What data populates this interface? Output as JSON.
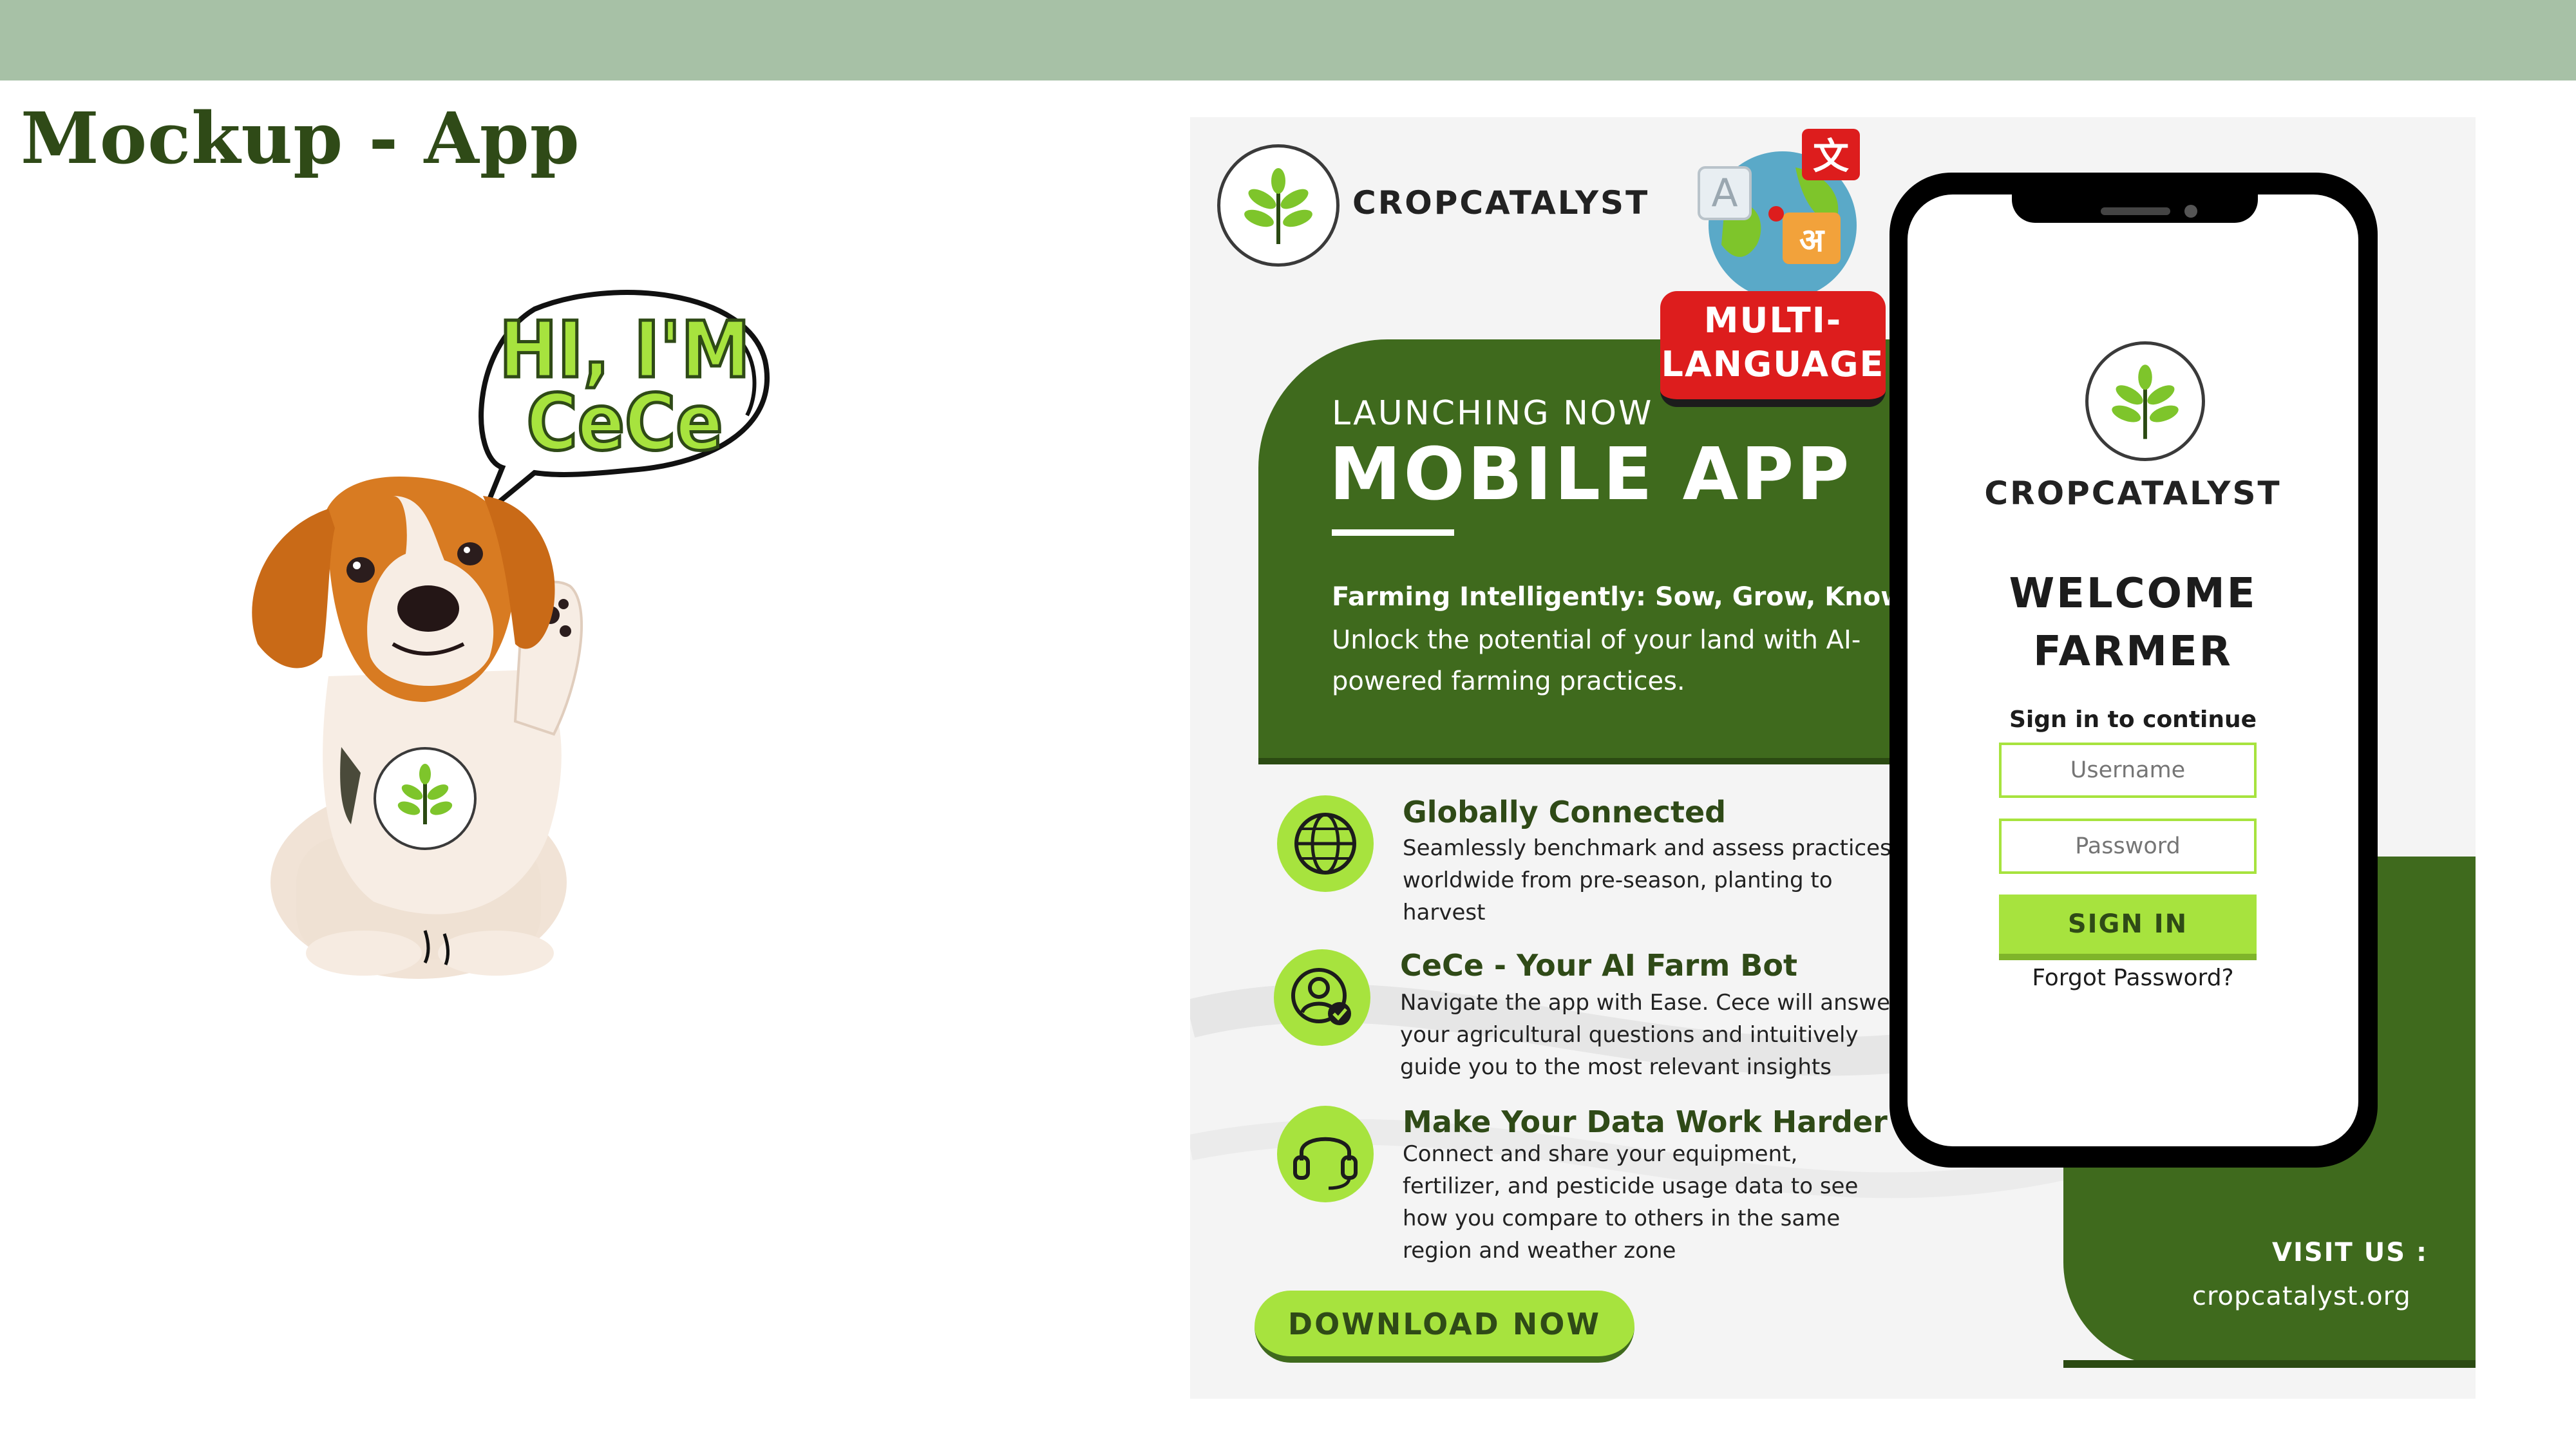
{
  "slide": {
    "title": "Mockup - App"
  },
  "mascot": {
    "speech_line1": "HI, I'M",
    "speech_line2": "CeCe"
  },
  "flyer": {
    "brand": "CROPCATALYST",
    "badge_line1": "MULTI-",
    "badge_line2": "LANGUAGE",
    "launch_label": "LAUNCHING NOW",
    "headline": "MOBILE APP",
    "tagline": "Farming Intelligently: Sow, Grow, Know.",
    "description": "Unlock the potential of your land with AI-powered farming practices.",
    "features": [
      {
        "title": "Globally Connected",
        "desc": "Seamlessly benchmark and assess practices worldwide from pre-season, planting to harvest",
        "icon": "globe-icon"
      },
      {
        "title": "CeCe - Your AI Farm Bot",
        "desc": "Navigate the app with Ease. Cece will answer your agricultural questions and intuitively guide you to the most relevant insights",
        "icon": "user-check-icon"
      },
      {
        "title": "Make Your Data Work Harder",
        "desc": "Connect and share your equipment, fertilizer, and pesticide usage data to see how you compare to others in the same region and weather zone",
        "icon": "headset-icon"
      }
    ],
    "download_label": "DOWNLOAD NOW",
    "visit_label": "VISIT US :",
    "visit_url": "cropcatalyst.org"
  },
  "phone": {
    "brand": "CROPCATALYST",
    "welcome_line1": "WELCOME",
    "welcome_line2": "FARMER",
    "signin_note": "Sign in to continue",
    "username_placeholder": "Username",
    "password_placeholder": "Password",
    "signin_label": "SIGN IN",
    "forgot_label": "Forgot Password?"
  },
  "colors": {
    "dark_green": "#3f6a1d",
    "lime": "#a7e33e",
    "sage_bar": "#a7c1a6",
    "badge_red": "#dd1d1d"
  }
}
